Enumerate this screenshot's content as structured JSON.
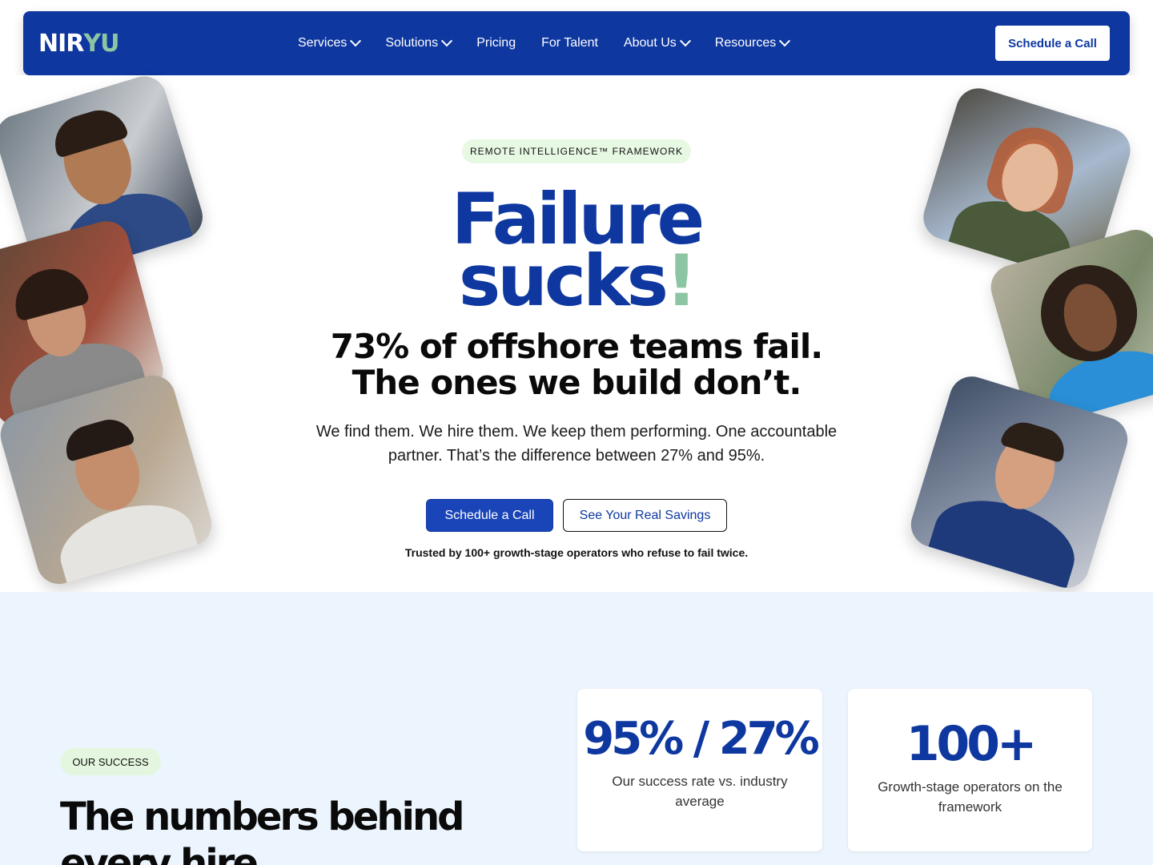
{
  "nav": {
    "logo_part1": "NIR",
    "logo_part2": "YU",
    "items": [
      {
        "label": "Services",
        "has_dropdown": true
      },
      {
        "label": "Solutions",
        "has_dropdown": true
      },
      {
        "label": "Pricing",
        "has_dropdown": false
      },
      {
        "label": "For Talent",
        "has_dropdown": false
      },
      {
        "label": "About Us",
        "has_dropdown": true
      },
      {
        "label": "Resources",
        "has_dropdown": true
      }
    ],
    "cta_label": "Schedule a Call"
  },
  "hero": {
    "badge": "REMOTE INTELLIGENCE™ FRAMEWORK",
    "headline_line1": "Failure",
    "headline_line2": "sucks",
    "headline_bang": "!",
    "sub_line1": "73% of offshore teams fail.",
    "sub_line2": "The ones we build don’t.",
    "paragraph": "We find them. We hire them. We keep them performing. One accountable partner. That’s the difference between 27% and 95%.",
    "primary_button": "Schedule a Call",
    "secondary_button": "See Your Real Savings",
    "trusted_text": "Trusted by 100+ growth-stage operators who refuse to fail twice."
  },
  "success": {
    "badge": "OUR SUCCESS",
    "title_line1": "The numbers behind",
    "title_line2": "every hire",
    "stats": [
      {
        "value": "95% / 27%",
        "label": "Our success rate vs. industry average"
      },
      {
        "value": "100+",
        "label": "Growth-stage operators on the framework"
      }
    ]
  },
  "colors": {
    "brand_blue": "#0e37a0",
    "accent_green": "#8cc5a3",
    "badge_green_bg": "#e7f8e3",
    "section_bg": "#ecf5fd"
  }
}
